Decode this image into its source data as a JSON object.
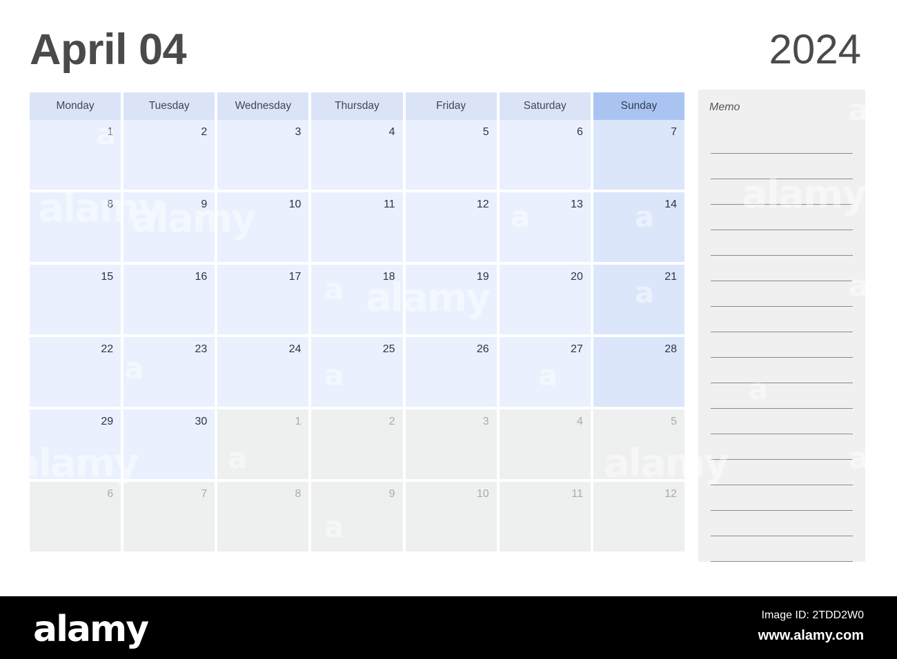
{
  "header": {
    "month_title": "April 04",
    "year": "2024"
  },
  "colors": {
    "weekday_header_bg": "#dbe4f7",
    "sunday_header_bg": "#aac4f2",
    "day_cell_bg": "#eaf0fd",
    "sunday_cell_bg": "#dbe6fb",
    "other_month_bg": "#eeefef",
    "memo_bg": "#f0f0f0",
    "text_dark": "#4a4a4a",
    "text_muted": "#aaaaaa",
    "bar_bg": "#000000"
  },
  "calendar": {
    "weekdays": [
      "Monday",
      "Tuesday",
      "Wednesday",
      "Thursday",
      "Friday",
      "Saturday",
      "Sunday"
    ],
    "weeks": [
      [
        {
          "num": "1",
          "in_month": true
        },
        {
          "num": "2",
          "in_month": true
        },
        {
          "num": "3",
          "in_month": true
        },
        {
          "num": "4",
          "in_month": true
        },
        {
          "num": "5",
          "in_month": true
        },
        {
          "num": "6",
          "in_month": true
        },
        {
          "num": "7",
          "in_month": true
        }
      ],
      [
        {
          "num": "8",
          "in_month": true
        },
        {
          "num": "9",
          "in_month": true
        },
        {
          "num": "10",
          "in_month": true
        },
        {
          "num": "11",
          "in_month": true
        },
        {
          "num": "12",
          "in_month": true
        },
        {
          "num": "13",
          "in_month": true
        },
        {
          "num": "14",
          "in_month": true
        }
      ],
      [
        {
          "num": "15",
          "in_month": true
        },
        {
          "num": "16",
          "in_month": true
        },
        {
          "num": "17",
          "in_month": true
        },
        {
          "num": "18",
          "in_month": true
        },
        {
          "num": "19",
          "in_month": true
        },
        {
          "num": "20",
          "in_month": true
        },
        {
          "num": "21",
          "in_month": true
        }
      ],
      [
        {
          "num": "22",
          "in_month": true
        },
        {
          "num": "23",
          "in_month": true
        },
        {
          "num": "24",
          "in_month": true
        },
        {
          "num": "25",
          "in_month": true
        },
        {
          "num": "26",
          "in_month": true
        },
        {
          "num": "27",
          "in_month": true
        },
        {
          "num": "28",
          "in_month": true
        }
      ],
      [
        {
          "num": "29",
          "in_month": true
        },
        {
          "num": "30",
          "in_month": true
        },
        {
          "num": "1",
          "in_month": false
        },
        {
          "num": "2",
          "in_month": false
        },
        {
          "num": "3",
          "in_month": false
        },
        {
          "num": "4",
          "in_month": false
        },
        {
          "num": "5",
          "in_month": false
        }
      ],
      [
        {
          "num": "6",
          "in_month": false
        },
        {
          "num": "7",
          "in_month": false
        },
        {
          "num": "8",
          "in_month": false
        },
        {
          "num": "9",
          "in_month": false
        },
        {
          "num": "10",
          "in_month": false
        },
        {
          "num": "11",
          "in_month": false
        },
        {
          "num": "12",
          "in_month": false
        }
      ]
    ]
  },
  "memo": {
    "title": "Memo",
    "line_count": 17
  },
  "watermark": {
    "text": "alamy",
    "short": "a"
  },
  "footer": {
    "logo": "alamy",
    "image_id": "Image ID: 2TDD2W0",
    "url": "www.alamy.com"
  }
}
